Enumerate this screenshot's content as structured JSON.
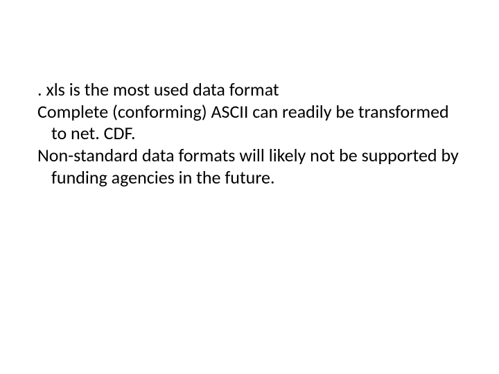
{
  "slide": {
    "paragraphs": [
      ". xls is the most used data format",
      "Complete (conforming) ASCII can readily be transformed to net. CDF.",
      "Non-standard data formats will likely not be supported by funding agencies in the future."
    ]
  }
}
